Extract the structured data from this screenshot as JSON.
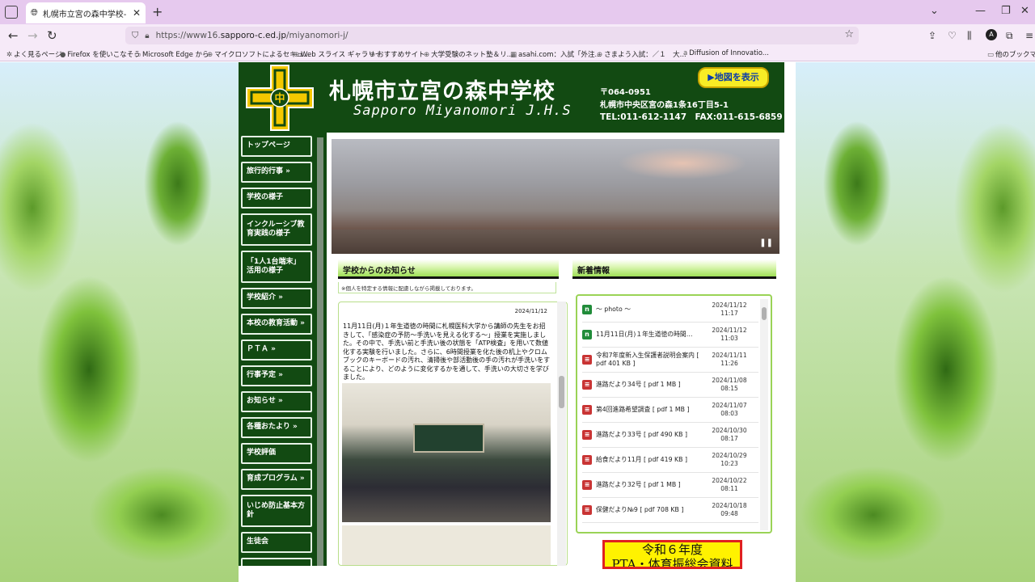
{
  "browser": {
    "tab_title": "札幌市立宮の森中学校-トップペ",
    "url_prefix": "https://www16.",
    "url_domain": "sapporo-c.ed.jp",
    "url_path": "/miyanomori-j/",
    "bookmarks": [
      "よく見るページ",
      "Firefox を使いこなそう",
      "Microsoft Edge から",
      "マイクロソフトによるセキュ...",
      "Web スライス ギャラリー",
      "おすすめサイト",
      "大学受験のネット塾＆リ...",
      "asahi.com：入試「外注...",
      "さまよう入試：／１　大...",
      "Diffusion of Innovatio...",
      "他のブックマーク"
    ]
  },
  "header": {
    "school_name": "札幌市立宮の森中学校",
    "school_name_en": "Sapporo Miyanomori J.H.S",
    "postal": "〒064-0951",
    "address": "札幌市中央区宮の森1条16丁目5-1",
    "phone": "TEL:011-612-1147　FAX:011-615-6859",
    "map_button": "▶地図を表示",
    "emblem_char": "中"
  },
  "sidebar": {
    "items": [
      {
        "label": "トップページ"
      },
      {
        "label": "旅行的行事 »"
      },
      {
        "label": "学校の様子"
      },
      {
        "label": "インクルーシブ教育実践の様子"
      },
      {
        "label": "「1人1台端末」活用の様子"
      },
      {
        "label": "学校紹介 »"
      },
      {
        "label": "本校の教育活動 »"
      },
      {
        "label": "ＰＴＡ »"
      },
      {
        "label": "行事予定 »"
      },
      {
        "label": "お知らせ »"
      },
      {
        "label": "各種おたより »"
      },
      {
        "label": "学校評価"
      },
      {
        "label": "育成プログラム »"
      },
      {
        "label": "いじめ防止基本方針"
      },
      {
        "label": "生徒会"
      }
    ]
  },
  "notices": {
    "heading": "学校からのお知らせ",
    "note": "※個人を特定する情報に配慮しながら掲載しております。",
    "date": "2024/11/12",
    "body": "11月11日(月)１年生道徳の時間に札幌医科大学から講師の先生をお招きして、「感染症の予防～手洗いを見える化する～」授業を実施しました。その中で、手洗い前と手洗い後の状態を「ATP検査」を用いて数値化する実験を行いました。さらに、6時間授業を化た後の机上やクロムブックのキーボードの汚れ、清掃後や部活動後の手の汚れが手洗いをすることにより、どのように変化するかを通して、手洗いの大切さを学びました。"
  },
  "news": {
    "heading": "新着情報",
    "items": [
      {
        "icon": "web",
        "title": "～ photo ～",
        "date": "2024/11/12",
        "time": "11:17"
      },
      {
        "icon": "web",
        "title": "11月11日(月)１年生道徳の時間…",
        "date": "2024/11/12",
        "time": "11:03"
      },
      {
        "icon": "pdf",
        "title": "令和7年度新入生保護者説明会案内 [ pdf 401 KB ]",
        "date": "2024/11/11",
        "time": "11:26"
      },
      {
        "icon": "pdf",
        "title": "進路だより34号 [ pdf 1 MB ]",
        "date": "2024/11/08",
        "time": "08:15"
      },
      {
        "icon": "pdf",
        "title": "第4回進路希望調査 [ pdf 1 MB ]",
        "date": "2024/11/07",
        "time": "08:03"
      },
      {
        "icon": "pdf",
        "title": "進路だより33号 [ pdf 490 KB ]",
        "date": "2024/10/30",
        "time": "08:17"
      },
      {
        "icon": "pdf",
        "title": "給食だより11月 [ pdf 419 KB ]",
        "date": "2024/10/29",
        "time": "10:23"
      },
      {
        "icon": "pdf",
        "title": "進路だより32号 [ pdf 1 MB ]",
        "date": "2024/10/22",
        "time": "08:11"
      },
      {
        "icon": "pdf",
        "title": "保健だより№9 [ pdf 708 KB ]",
        "date": "2024/10/18",
        "time": "09:48"
      }
    ]
  },
  "pta_banner": {
    "line1": "令和６年度",
    "line2": "PTA・体育振総会資料"
  },
  "colors": {
    "header_bg": "#124a12",
    "map_button_bg": "#f8ec25",
    "section_head": "#9fe057",
    "pdf_icon": "#c93434",
    "web_icon": "#218c3a"
  }
}
